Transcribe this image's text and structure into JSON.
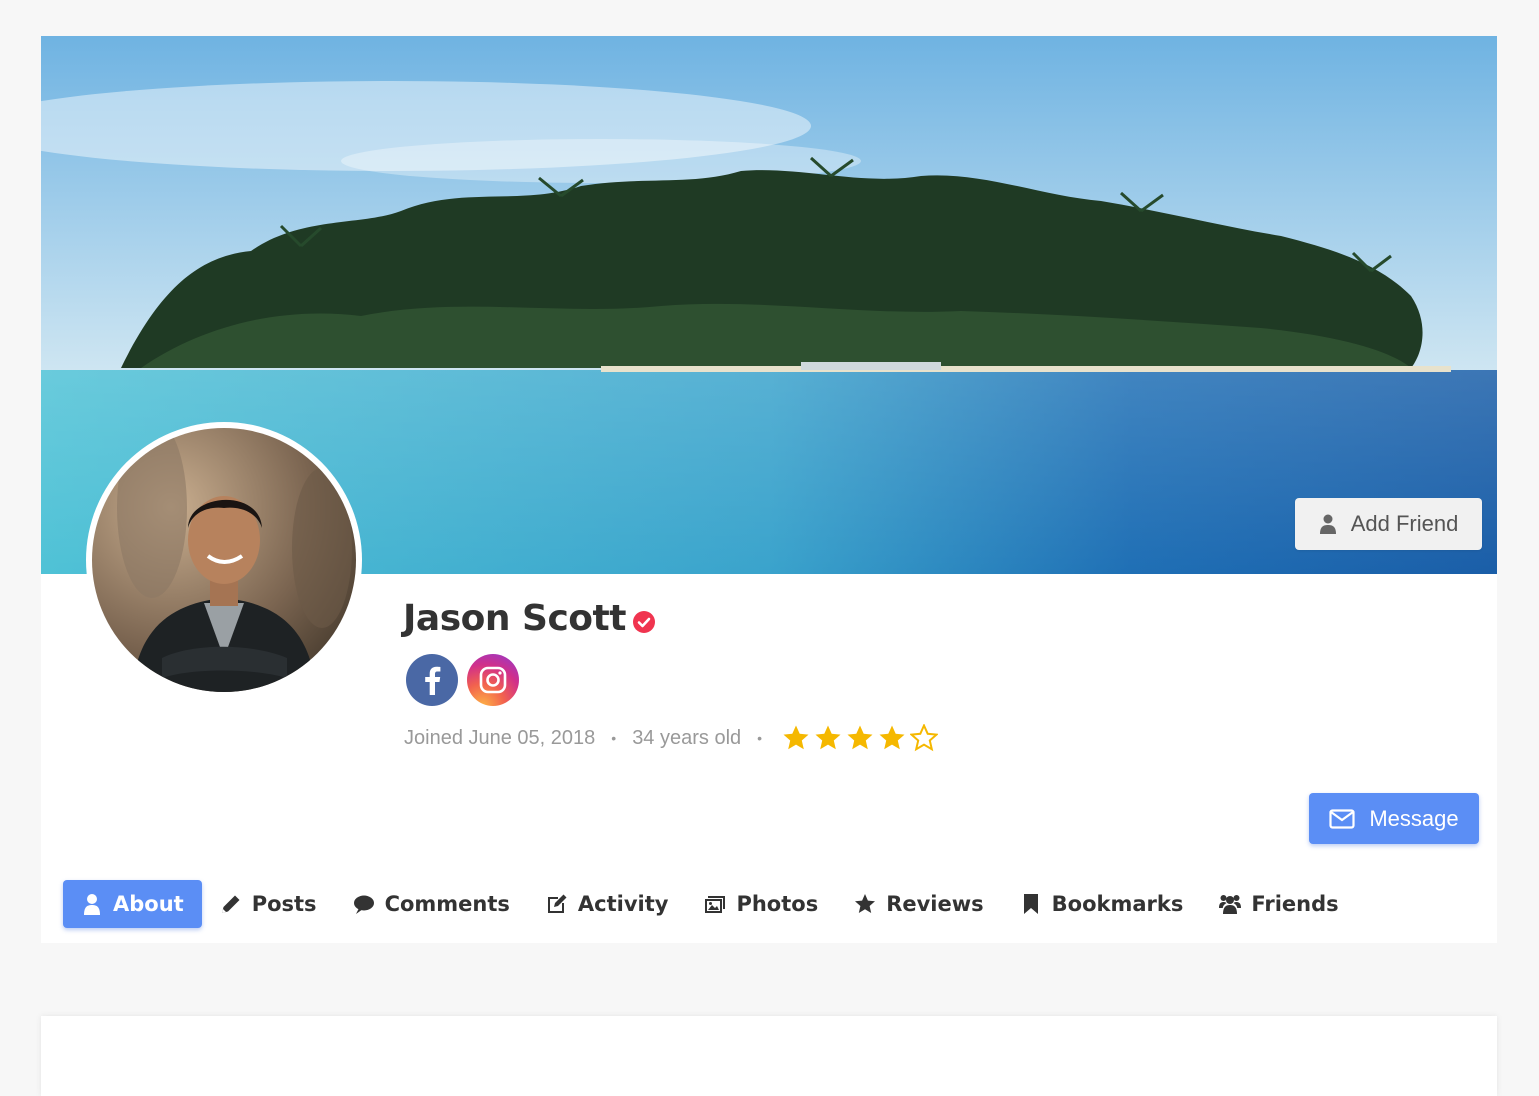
{
  "profile": {
    "name": "Jason Scott",
    "joined": "Joined June 05, 2018",
    "age": "34 years old",
    "separator": "•",
    "rating": 4,
    "rating_max": 5
  },
  "socials": [
    {
      "name": "facebook",
      "icon": "facebook-icon"
    },
    {
      "name": "instagram",
      "icon": "instagram-icon"
    }
  ],
  "actions": {
    "add_friend_label": "Add Friend",
    "message_label": "Message"
  },
  "tabs": [
    {
      "label": "About",
      "icon": "user-icon",
      "active": true
    },
    {
      "label": "Posts",
      "icon": "pencil-icon",
      "active": false
    },
    {
      "label": "Comments",
      "icon": "comment-icon",
      "active": false
    },
    {
      "label": "Activity",
      "icon": "edit-icon",
      "active": false
    },
    {
      "label": "Photos",
      "icon": "images-icon",
      "active": false
    },
    {
      "label": "Reviews",
      "icon": "star-icon",
      "active": false
    },
    {
      "label": "Bookmarks",
      "icon": "bookmark-icon",
      "active": false
    },
    {
      "label": "Friends",
      "icon": "users-icon",
      "active": false
    }
  ],
  "colors": {
    "accent": "#5b8ef5",
    "star": "#f5b800",
    "verified": "#f0344f",
    "facebook": "#4a68a5"
  }
}
